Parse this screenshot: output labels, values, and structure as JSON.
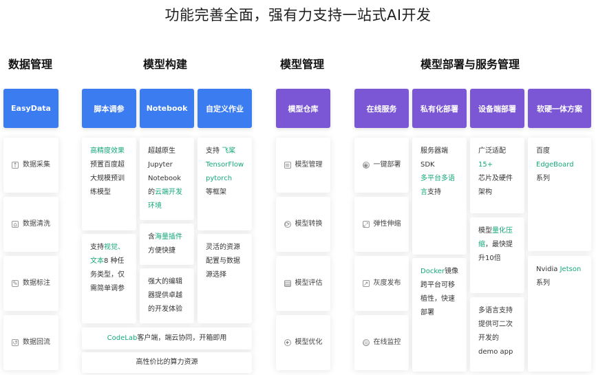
{
  "title": "功能完善全面，强有力支持一站式AI开发",
  "sections": [
    "数据管理",
    "模型构建",
    "模型管理",
    "模型部署与服务管理"
  ],
  "headers": {
    "easydata": "EasyData",
    "script": "脚本调参",
    "notebook": "Notebook",
    "custom": "自定义作业",
    "repo": "模型仓库",
    "online": "在线服务",
    "private": "私有化部署",
    "device": "设备端部署",
    "hardware": "软硬一体方案"
  },
  "data_items": [
    "数据采集",
    "数据清洗",
    "数据标注",
    "数据回流"
  ],
  "script_cards": {
    "c1_hl": "高精度效果",
    "c1_text": "预置百度超大规模预训练模型",
    "c2_a": "支持",
    "c2_hl": "视觉、文本",
    "c2_b": "8 种任务类型，仅需简单调参"
  },
  "notebook_cards": {
    "c1_a": "超越原生Jupyter Notebook的",
    "c1_hl": "云端开发环境",
    "c2_a": "含",
    "c2_hl": "海量插件",
    "c2_b": "方便快捷",
    "c3": "强大的编辑器提供卓越的开发体验"
  },
  "custom_cards": {
    "c1_a": "支持 ",
    "c1_hl": "飞桨 TensorFlow pytorch",
    "c1_b": "等框架",
    "c2": "灵活的资源配置与数据源选择"
  },
  "codelab": {
    "hl": "CodeLab",
    "text": "客户端，端云协同，开箱即用"
  },
  "compute": "高性价比的算力资源",
  "repo_items": [
    "模型管理",
    "模型转换",
    "模型评估",
    "模型优化"
  ],
  "online_items": [
    "一键部署",
    "弹性伸缩",
    "灰度发布",
    "在线监控"
  ],
  "private_cards": {
    "c1_a": "服务器端SDK",
    "c1_hl": "多平台多语言",
    "c1_b": "支持",
    "c2_hl": "Docker",
    "c2_b": "镜像跨平台可移植性，快速部署"
  },
  "device_cards": {
    "c1_a": "广泛适配",
    "c1_hl": "15+",
    "c1_b": "芯片及硬件架构",
    "c2_a": "模型",
    "c2_hl": "量化压缩",
    "c2_b": "，最快提升10倍",
    "c3": "多语言支持提供可二次开发的demo app"
  },
  "hardware_cards": {
    "c1_a": "百度",
    "c1_hl": "EdgeBoard",
    "c1_b": "系列",
    "c2_a": "Nvidia ",
    "c2_hl": "Jetson",
    "c2_b": "系列"
  },
  "colors": {
    "blue": "#3b7cf0",
    "purple": "#7b57d6",
    "highlight": "#16a87c"
  }
}
